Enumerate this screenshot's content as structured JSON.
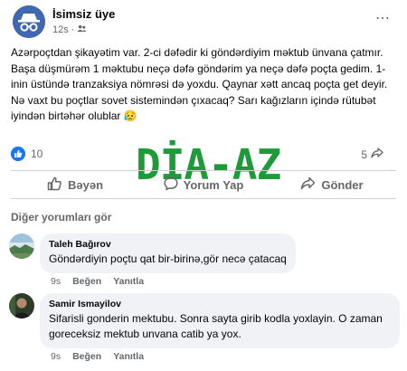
{
  "post": {
    "author": "İsimsiz üye",
    "time": "12s",
    "time_separator": "·",
    "more_icon": "⋯",
    "body": [
      "Azərpoçtdan şikayətim var. 2-ci dəfədir ki göndərdiyim məktub ünvana çatmır. Başa düşmürəm 1 məktubu neçə dəfə göndərim ya neçə dəfə poçta gedim. 1-inin üstündə tranzaksiya nömrəsi də yoxdu. Qaynar xətt ancaq poçta get deyir.",
      "Nə vaxt bu poçtlar sovet sistemindən çıxacaq?  Sarı kağızların içində rütubət iyindən birtəhər olublar 😥"
    ],
    "likes": "10",
    "shares": "5"
  },
  "watermark": "DİA-AZ",
  "actions": {
    "like": "Bəyən",
    "comment": "Yorum Yap",
    "share": "Gönder"
  },
  "comments_section": {
    "more_label": "Diğer yorumları gör",
    "comments": [
      {
        "author": "Taleh Bağırov",
        "text": "Göndərdiyin poçtu qat bir-birinə,gör necə çatacaq",
        "time": "9s",
        "like": "Beğen",
        "reply": "Yanıtla"
      },
      {
        "author": "Samir Ismayilov",
        "text": "Sifarisli gonderin mektubu. Sonra sayta girib kodla yoxlayin. O zaman goreceksiz mektub unvana catib ya yox.",
        "time": "9s",
        "like": "Beğen",
        "reply": "Yanıtla"
      }
    ]
  },
  "colors": {
    "accent": "#1877f2",
    "watermark": "#1f9a3a",
    "bubble": "#f0f2f5",
    "muted": "#65676b"
  },
  "icons": {
    "avatar": "incognito-avatar-icon",
    "privacy": "friends-icon",
    "like_reaction": "like-reaction-icon",
    "share_count": "share-icon",
    "like_action": "thumbs-up-icon",
    "comment_action": "comment-icon",
    "share_action": "share-arrow-icon"
  }
}
